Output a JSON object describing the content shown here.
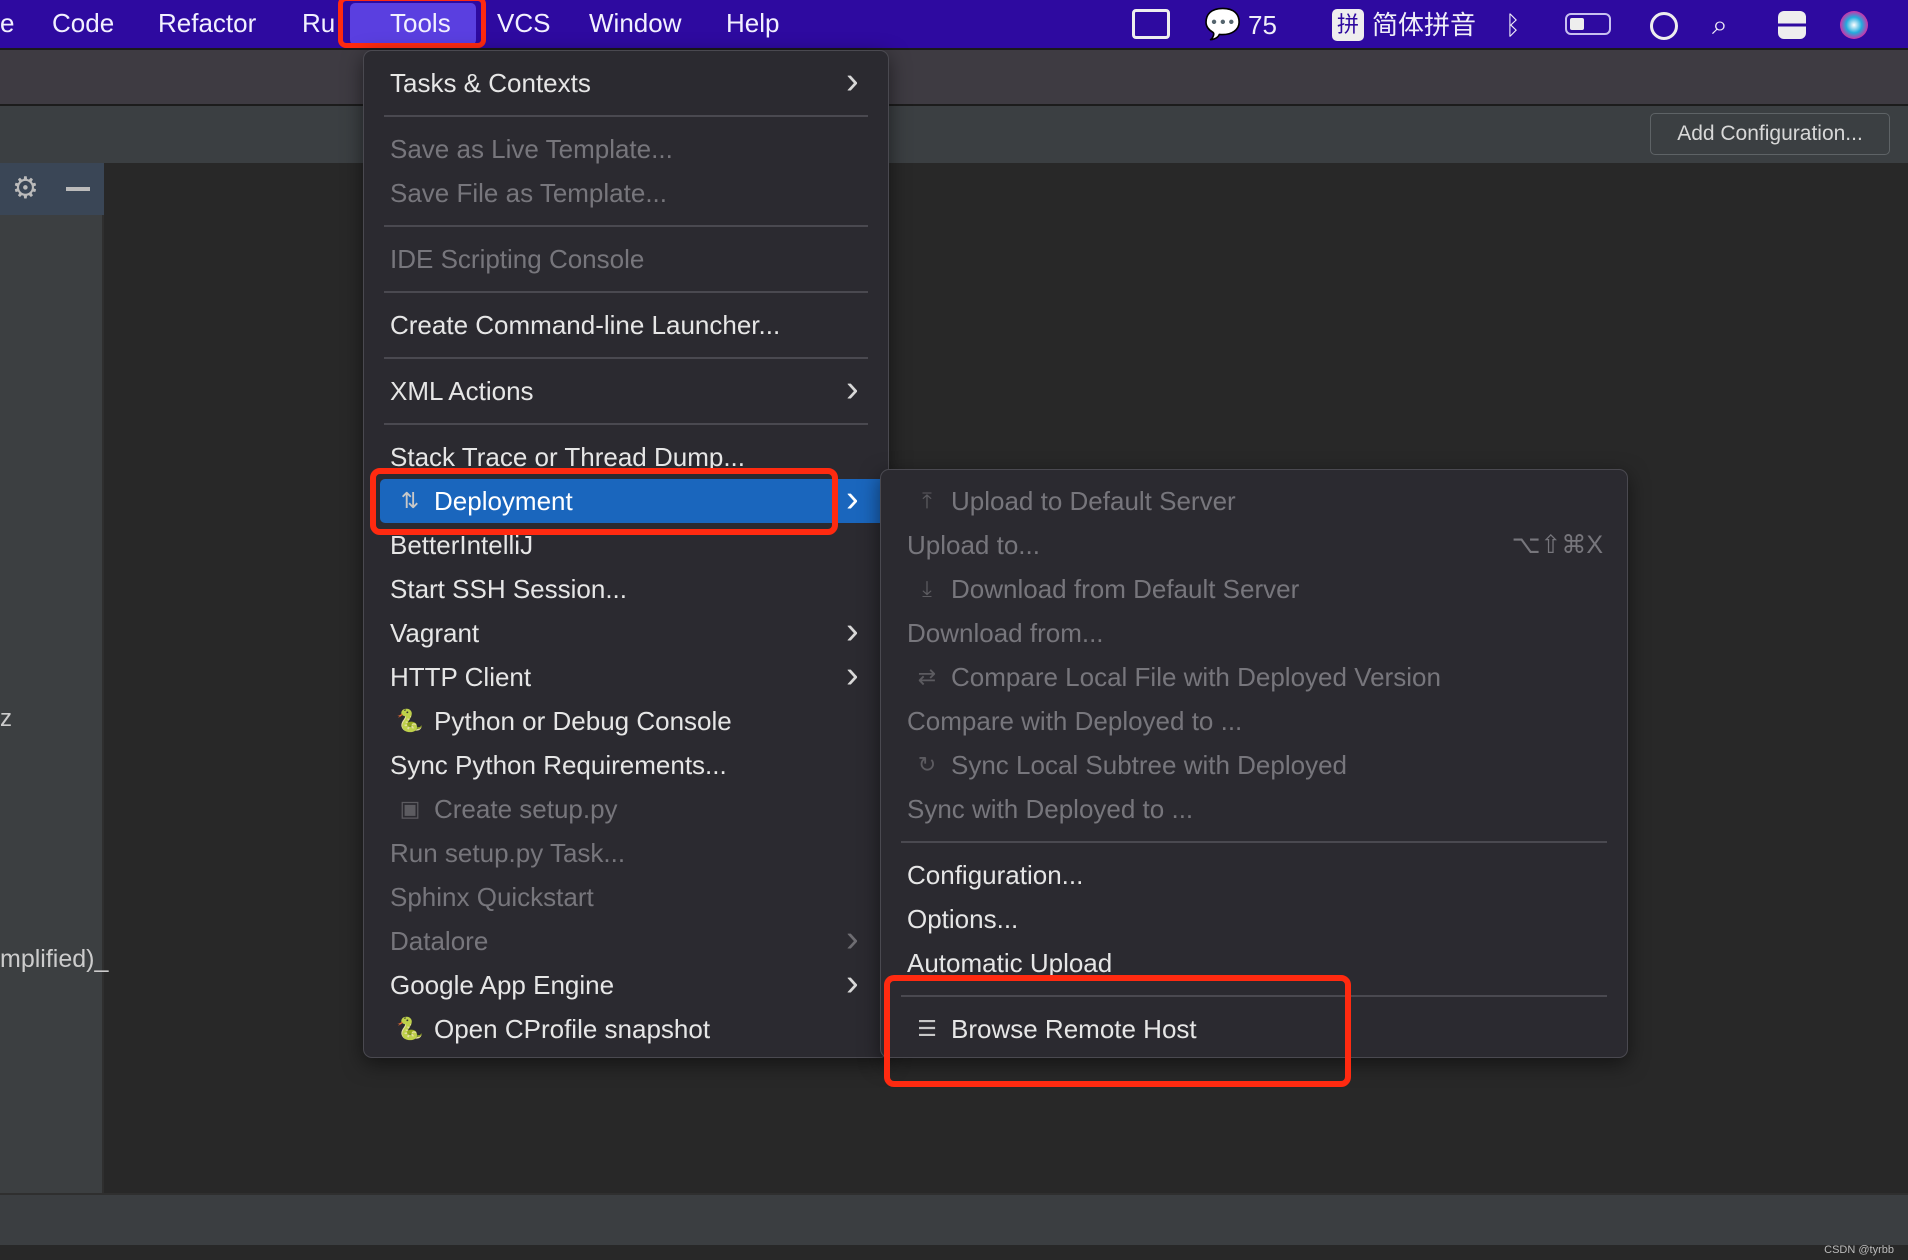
{
  "menubar": {
    "items": [
      "e",
      "Code",
      "Refactor",
      "Ru",
      "Tools",
      "VCS",
      "Window",
      "Help"
    ],
    "tray": {
      "wechat_count": "75",
      "input_method_icon": "拼",
      "input_method": "简体拼音",
      "icons": [
        "display-icon",
        "wechat-icon",
        "input-method-icon",
        "bluetooth-icon",
        "battery-icon",
        "user-icon",
        "search-icon",
        "control-center-icon",
        "siri-icon"
      ]
    }
  },
  "toolbar": {
    "add_configuration": "Add Configuration..."
  },
  "left_panel": {
    "fragment_1": "z",
    "fragment_2": "mplified)_"
  },
  "tools_menu": {
    "items": [
      {
        "label": "Tasks & Contexts",
        "submenu": true
      },
      {
        "sep": true
      },
      {
        "label": "Save as Live Template...",
        "disabled": true
      },
      {
        "label": "Save File as Template...",
        "disabled": true
      },
      {
        "sep": true
      },
      {
        "label": "IDE Scripting Console",
        "disabled": true
      },
      {
        "sep": true
      },
      {
        "label": "Create Command-line Launcher..."
      },
      {
        "sep": true
      },
      {
        "label": "XML Actions",
        "submenu": true
      },
      {
        "sep": true
      },
      {
        "label": "Stack Trace or Thread Dump..."
      },
      {
        "label": "Deployment",
        "submenu": true,
        "selected": true,
        "icon": "deployment-icon"
      },
      {
        "label": "BetterIntelliJ"
      },
      {
        "label": "Start SSH Session..."
      },
      {
        "label": "Vagrant",
        "submenu": true
      },
      {
        "label": "HTTP Client",
        "submenu": true
      },
      {
        "label": "Python or Debug Console",
        "icon": "python-icon"
      },
      {
        "label": "Sync Python Requirements..."
      },
      {
        "label": "Create setup.py",
        "disabled": true,
        "icon": "python-package-icon"
      },
      {
        "label": "Run setup.py Task...",
        "disabled": true
      },
      {
        "label": "Sphinx Quickstart",
        "disabled": true
      },
      {
        "label": "Datalore",
        "disabled": true,
        "submenu": true
      },
      {
        "label": "Google App Engine",
        "submenu": true
      },
      {
        "label": "Open CProfile snapshot",
        "icon": "cprofile-icon"
      }
    ]
  },
  "deployment_menu": {
    "items": [
      {
        "label": "Upload to Default Server",
        "disabled": true,
        "icon": "upload-icon"
      },
      {
        "label": "Upload to...",
        "disabled": true,
        "shortcut": "⌥⇧⌘X"
      },
      {
        "label": "Download from Default Server",
        "disabled": true,
        "icon": "download-icon"
      },
      {
        "label": "Download from...",
        "disabled": true
      },
      {
        "label": "Compare Local File with Deployed Version",
        "disabled": true,
        "icon": "compare-icon"
      },
      {
        "label": "Compare with Deployed to ...",
        "disabled": true
      },
      {
        "label": "Sync Local Subtree with Deployed",
        "disabled": true,
        "icon": "sync-icon"
      },
      {
        "label": "Sync with Deployed to ...",
        "disabled": true
      },
      {
        "sep": true
      },
      {
        "label": "Configuration..."
      },
      {
        "label": "Options..."
      },
      {
        "label": "Automatic Upload"
      },
      {
        "sep": true
      },
      {
        "label": "Browse Remote Host",
        "icon": "server-icon"
      }
    ]
  },
  "colors": {
    "menubar": "#2e0aa0",
    "selection": "#1a66bd",
    "annotation": "#ff2a10"
  },
  "watermark": "CSDN @tyrbb"
}
